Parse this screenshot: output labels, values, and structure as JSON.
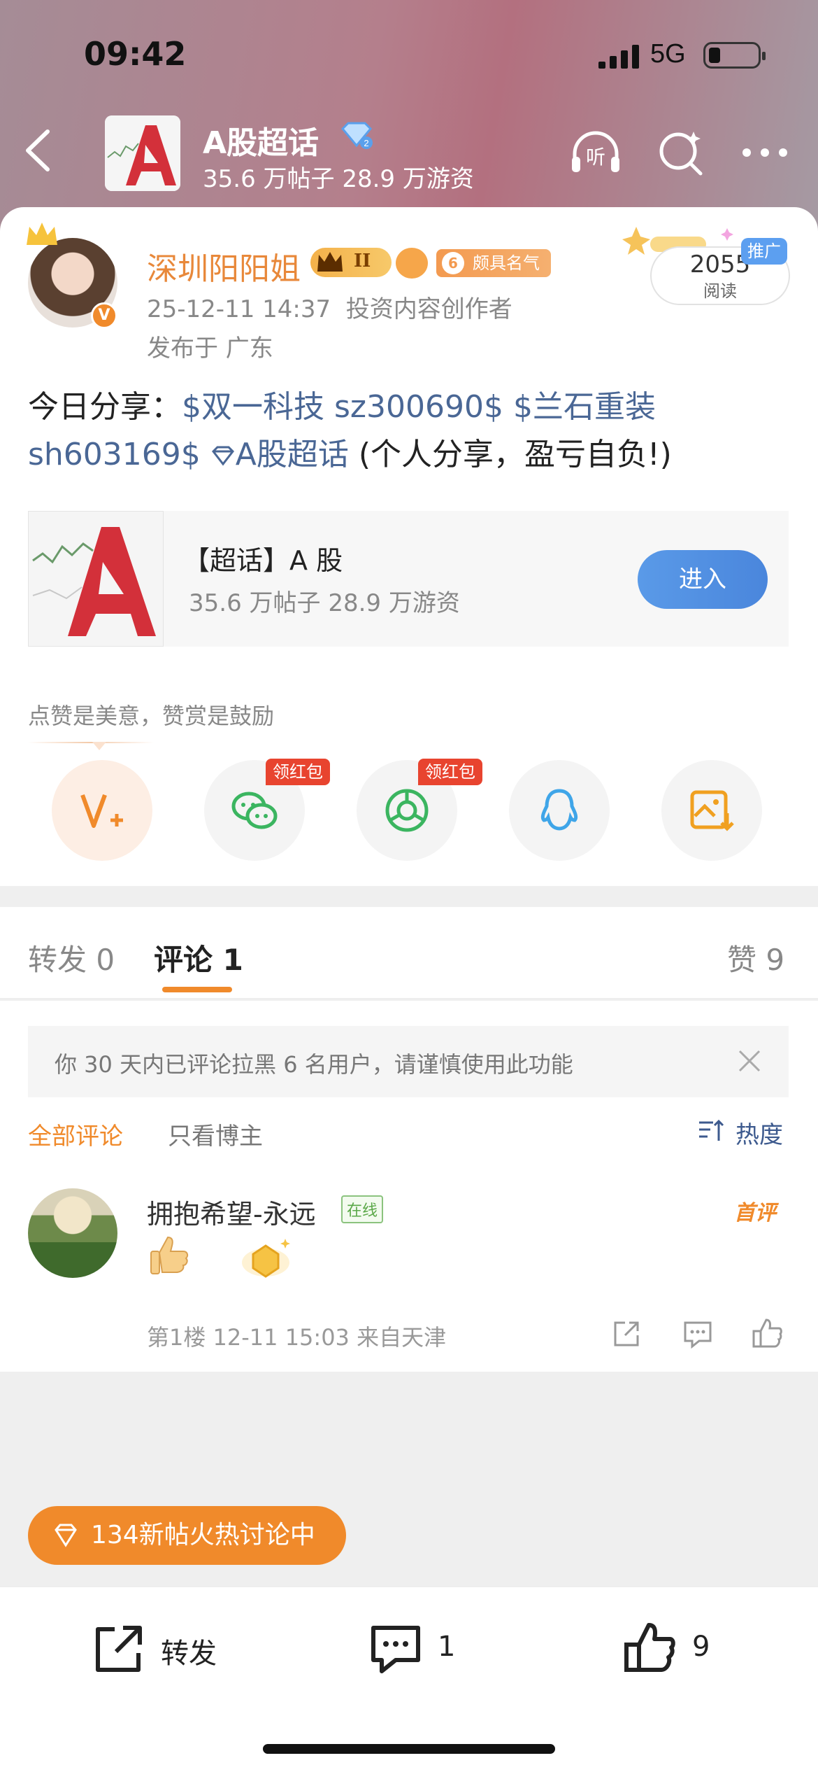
{
  "status_bar": {
    "time": "09:42",
    "network": "5G"
  },
  "header": {
    "title": "A股超话",
    "subtitle": "35.6 万帖子 28.9 万游资",
    "icons": [
      "back-icon",
      "listen-icon",
      "search-icon",
      "more-icon"
    ],
    "listen_label": "听"
  },
  "post": {
    "author": "深圳阳阳姐",
    "level_badge": "II",
    "fame_num": "6",
    "fame_label": "颇具名气",
    "time": "25-12-11 14:37",
    "role": "投资内容创作者",
    "location": "发布于 广东",
    "read_count": "2055",
    "read_label": "阅读",
    "promo_tag": "推广",
    "content": {
      "prefix": "今日分享：",
      "tag1": "$双一科技 sz300690$",
      "tag2": "$兰石重装 sh603169$",
      "topic": "A股超话",
      "suffix": " (个人分享，盈亏自负!)"
    },
    "topic_card": {
      "title": "【超话】A 股",
      "stats": "35.6 万帖子 28.9 万游资",
      "enter_label": "进入"
    },
    "tip": "点赞是美意，赞赏是鼓励",
    "share": {
      "red_packet_label": "领红包",
      "items": [
        "reward-icon",
        "wechat-icon",
        "moments-icon",
        "qq-icon",
        "save-image-icon"
      ]
    }
  },
  "tabs": {
    "repost": "转发 0",
    "comment": "评论 1",
    "like": "赞 9"
  },
  "comments": {
    "notice": "你 30 天内已评论拉黑 6 名用户，请谨慎使用此功能",
    "filter_all": "全部评论",
    "filter_blogger": "只看博主",
    "sort": "热度",
    "items": [
      {
        "name": "拥抱希望-永远",
        "online": "在线",
        "tag": "首评",
        "meta": "第1楼 12-11 15:03 来自天津"
      }
    ]
  },
  "hot_pill": "134新帖火热讨论中",
  "bottom_bar": {
    "repost": "转发",
    "comment_count": "1",
    "like_count": "9"
  },
  "colors": {
    "accent": "#f08a2b",
    "link": "#4a6795",
    "enter_button": "#4a86dc",
    "red_tag": "#e8442f"
  }
}
